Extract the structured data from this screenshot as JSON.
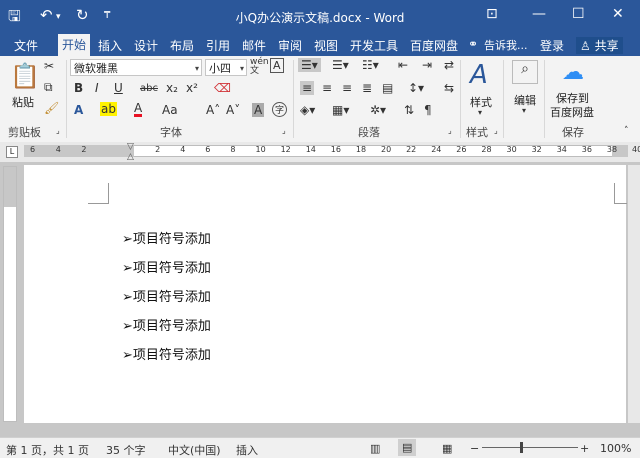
{
  "titlebar": {
    "title": "小Q办公演示文稿.docx - Word",
    "save_icon": "save-icon",
    "undo_icon": "undo-icon",
    "redo_icon": "redo-icon"
  },
  "tabs": [
    "文件",
    "开始",
    "插入",
    "设计",
    "布局",
    "引用",
    "邮件",
    "审阅",
    "视图",
    "开发工具",
    "百度网盘"
  ],
  "tell_me": "告诉我...",
  "login": "登录",
  "share": "共享",
  "ribbon": {
    "clipboard": {
      "paste": "粘贴",
      "label": "剪贴板"
    },
    "font": {
      "name": "微软雅黑",
      "size": "小四",
      "label": "字体",
      "bold": "B",
      "italic": "I",
      "underline": "U",
      "strike": "abc",
      "sub": "x₂",
      "sup": "x²",
      "aa": "Aa"
    },
    "paragraph": {
      "label": "段落"
    },
    "styles": {
      "button": "样式",
      "label": "样式"
    },
    "editing": {
      "button": "编辑"
    },
    "save": {
      "button_line1": "保存到",
      "button_line2": "百度网盘",
      "label": "保存"
    }
  },
  "ruler_ticks": [
    "6",
    "4",
    "2",
    "2",
    "4",
    "6",
    "8",
    "10",
    "12",
    "14",
    "16",
    "18",
    "20",
    "22",
    "24",
    "26",
    "28",
    "30",
    "32",
    "34",
    "36",
    "38",
    "40"
  ],
  "document": {
    "bullet_char": "➢",
    "items": [
      "项目符号添加",
      "项目符号添加",
      "项目符号添加",
      "项目符号添加",
      "项目符号添加"
    ]
  },
  "status": {
    "page": "第 1 页，共 1 页",
    "words": "35 个字",
    "lang": "中文(中国)",
    "mode": "插入",
    "zoom": "100%"
  }
}
